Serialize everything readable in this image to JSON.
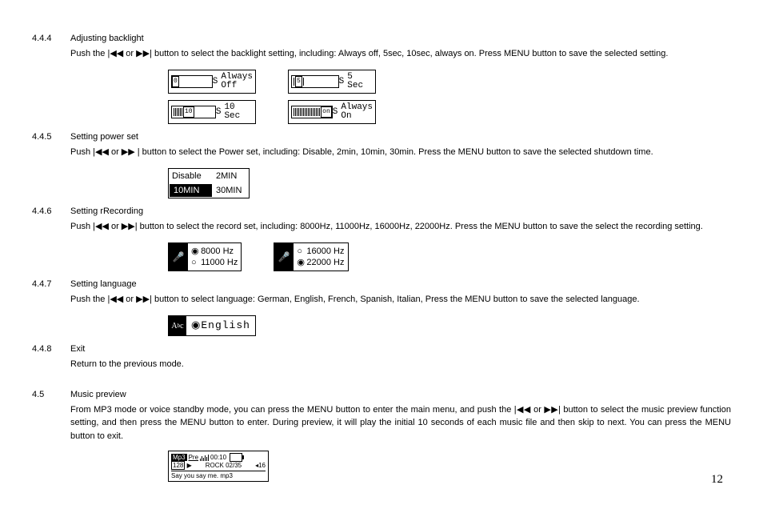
{
  "sections": {
    "s444": {
      "num": "4.4.4",
      "title": "Adjusting backlight",
      "para": "Push the  |◀◀  or  ▶▶|  button to select the backlight setting, including: Always off, 5sec, 10sec, always on. Press MENU button to save the selected setting.",
      "fig": {
        "opt1": {
          "value": "0",
          "side_suffix": "S",
          "label_top": "Always",
          "label_bot": "Off"
        },
        "opt2": {
          "value": "5",
          "side_suffix": "S",
          "label": "5 Sec"
        },
        "opt3": {
          "value": "10",
          "side_suffix": "S",
          "label": "10 Sec"
        },
        "opt4": {
          "value": "on",
          "side_suffix": "S",
          "label_top": "Always",
          "label_bot": "On"
        }
      }
    },
    "s445": {
      "num": "4.4.5",
      "title": "Setting power set",
      "para": "Push  |◀◀  or  ▶▶ |  button to select the Power set, including: Disable, 2min, 10min, 30min. Press the MENU button to save the selected shutdown time.",
      "fig": {
        "c1": "Disable",
        "c2": "2MIN",
        "c3": "10MIN",
        "c4": "30MIN"
      }
    },
    "s446": {
      "num": "4.4.6",
      "title": "Setting rRecording",
      "para": "Push  |◀◀  or  ▶▶|  button to select the record set, including: 8000Hz, 11000Hz, 16000Hz, 22000Hz. Press the MENU button to save the select the recording setting.",
      "fig": {
        "box1": {
          "o1_sel": "◉",
          "o1": "8000 Hz",
          "o2_sel": "○",
          "o2": "11000 Hz"
        },
        "box2": {
          "o1_sel": "○",
          "o1": "16000 Hz",
          "o2_sel": "◉",
          "o2": "22000 Hz"
        }
      }
    },
    "s447": {
      "num": "4.4.7",
      "title": "Setting language",
      "para": "Push the  |◀◀  or  ▶▶|   button to select language: German, English, French, Spanish, Italian, Press the MENU button to save the selected language.",
      "fig": {
        "sel": "◉",
        "label": "English"
      }
    },
    "s448": {
      "num": "4.4.8",
      "title": "Exit",
      "para": "Return to the previous mode."
    },
    "s45": {
      "num": "4.5",
      "title": "Music preview",
      "para": "From MP3 mode or voice standby mode, you can press the MENU button to enter the main menu, and push the  |◀◀  or  ▶▶|  button to select the music preview function setting, and then press the MENU button to enter. During preview, it will play the initial 10 seconds of each music file and then skip to next. You can press the MENU button to exit.",
      "fig": {
        "badge1": "Mp3",
        "badge2": "Pre",
        "time": "00:10",
        "bitrate": "128",
        "play": "▶",
        "eq_label": "ROCK",
        "track": "02/35",
        "vol": "◂16",
        "filename": "Say you say me. mp3"
      }
    }
  },
  "page_number": "12"
}
